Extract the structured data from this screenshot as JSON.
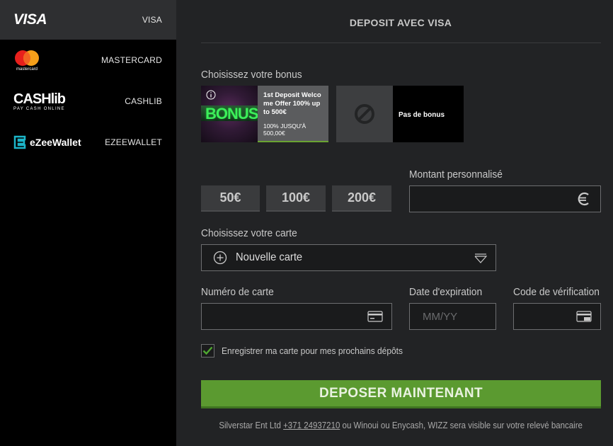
{
  "sidebar": {
    "methods": [
      {
        "label": "VISA",
        "logo": "VISA",
        "active": true
      },
      {
        "label": "MASTERCARD",
        "logo_sub": "mastercard"
      },
      {
        "label": "CASHLIB",
        "logo": "CASHlib",
        "logo_sub": "PAY CASH ONLINE"
      },
      {
        "label": "EZEEWALLET",
        "logo": "eZeeWallet"
      }
    ]
  },
  "main": {
    "title": "DEPOSIT AVEC VISA",
    "bonus_label": "Choisissez votre bonus",
    "bonuses": [
      {
        "image_text": "BONUS",
        "title": "1st Deposit Welcome Offer 100% up to 500€",
        "subtitle": "100% JUSQU'À 500,00€",
        "icon": "info-icon"
      },
      {
        "title": "Pas de bonus",
        "icon": "no-bonus-icon"
      }
    ],
    "amounts": [
      "50€",
      "100€",
      "200€"
    ],
    "custom_amount_label": "Montant personnalisé",
    "custom_amount_icon": "euro-icon",
    "card_label": "Choisissez votre carte",
    "card_select": {
      "value": "Nouvelle carte"
    },
    "card_number_label": "Numéro de carte",
    "expiry_label": "Date d'expiration",
    "expiry_placeholder": "MM/YY",
    "cvv_label": "Code de vérification",
    "save_card_label": "Enregistrer ma carte pour mes prochains dépôts",
    "save_card_checked": true,
    "deposit_button": "DEPOSER MAINTENANT",
    "footer": {
      "prefix": "Silverstar Ent Ltd ",
      "phone": "+371 24937210",
      "suffix": " ou Winoui ou Enycash, WIZZ sera visible sur votre relevé bancaire"
    }
  },
  "colors": {
    "accent": "#5b9a30",
    "sidebar_bg": "#000000",
    "main_bg": "#222325",
    "active_item": "#2e2f31"
  }
}
